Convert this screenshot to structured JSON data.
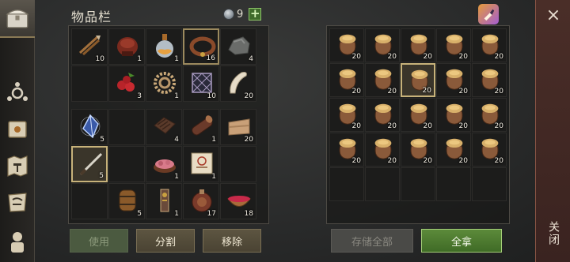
{
  "header": {
    "title": "物品栏",
    "currency_value": "9",
    "plus_label": "+"
  },
  "close": {
    "x_label": "×",
    "label": "关闭"
  },
  "sidebar": {
    "items": [
      {
        "icon": "chest-icon"
      },
      {
        "icon": "skills-icon"
      },
      {
        "icon": "crafting-book-icon"
      },
      {
        "icon": "build-map-icon"
      },
      {
        "icon": "recipe-scroll-icon"
      },
      {
        "icon": "character-icon"
      }
    ]
  },
  "inventory": {
    "top": [
      {
        "icon": "crossbow-bolts-icon",
        "qty": "10"
      },
      {
        "icon": "leather-helmet-icon",
        "qty": "1"
      },
      {
        "icon": "potion-flask-icon",
        "qty": "1"
      },
      {
        "icon": "collar-icon",
        "qty": "16"
      },
      {
        "icon": "stone-icon",
        "qty": "4"
      },
      {
        "icon": "",
        "qty": ""
      },
      {
        "icon": "berries-icon",
        "qty": "3"
      },
      {
        "icon": "rope-icon",
        "qty": "1"
      },
      {
        "icon": "net-trap-icon",
        "qty": "10"
      },
      {
        "icon": "fang-icon",
        "qty": "20"
      }
    ],
    "bottom": [
      {
        "icon": "crystal-icon",
        "qty": "5"
      },
      {
        "icon": "",
        "qty": ""
      },
      {
        "icon": "plank-icon",
        "qty": "4"
      },
      {
        "icon": "log-icon",
        "qty": "1"
      },
      {
        "icon": "cloth-icon",
        "qty": "20"
      },
      {
        "icon": "sword-icon",
        "qty": "5"
      },
      {
        "icon": "",
        "qty": ""
      },
      {
        "icon": "meat-bowl-icon",
        "qty": "1"
      },
      {
        "icon": "blueprint-icon",
        "qty": "1"
      },
      {
        "icon": "",
        "qty": ""
      },
      {
        "icon": "",
        "qty": ""
      },
      {
        "icon": "barrel-icon",
        "qty": "5"
      },
      {
        "icon": "key-icon",
        "qty": "1"
      },
      {
        "icon": "canteen-icon",
        "qty": "17"
      },
      {
        "icon": "berry-bowl-icon",
        "qty": "18"
      }
    ]
  },
  "storage": {
    "slots": [
      {
        "icon": "grain-sack-icon",
        "qty": "20"
      },
      {
        "icon": "grain-sack-icon",
        "qty": "20"
      },
      {
        "icon": "grain-sack-icon",
        "qty": "20"
      },
      {
        "icon": "grain-sack-icon",
        "qty": "20"
      },
      {
        "icon": "grain-sack-icon",
        "qty": "20"
      },
      {
        "icon": "grain-sack-icon",
        "qty": "20"
      },
      {
        "icon": "grain-sack-icon",
        "qty": "20"
      },
      {
        "icon": "grain-sack-icon",
        "qty": "20"
      },
      {
        "icon": "grain-sack-icon",
        "qty": "20"
      },
      {
        "icon": "grain-sack-icon",
        "qty": "20"
      },
      {
        "icon": "grain-sack-icon",
        "qty": "20"
      },
      {
        "icon": "grain-sack-icon",
        "qty": "20"
      },
      {
        "icon": "grain-sack-icon",
        "qty": "20"
      },
      {
        "icon": "grain-sack-icon",
        "qty": "20"
      },
      {
        "icon": "grain-sack-icon",
        "qty": "20"
      },
      {
        "icon": "grain-sack-icon",
        "qty": "20"
      },
      {
        "icon": "grain-sack-icon",
        "qty": "20"
      },
      {
        "icon": "grain-sack-icon",
        "qty": "20"
      },
      {
        "icon": "grain-sack-icon",
        "qty": "20"
      },
      {
        "icon": "grain-sack-icon",
        "qty": "20"
      },
      {
        "icon": "",
        "qty": ""
      },
      {
        "icon": "",
        "qty": ""
      },
      {
        "icon": "",
        "qty": ""
      },
      {
        "icon": "",
        "qty": ""
      },
      {
        "icon": "",
        "qty": ""
      }
    ]
  },
  "buttons": {
    "use": "使用",
    "split": "分割",
    "remove": "移除",
    "store_all": "存储全部",
    "take_all": "全拿"
  },
  "colors": {
    "accent_green": "#3f6b2b",
    "close_panel": "#4a2e28",
    "highlight_border": "#c7b27a"
  }
}
